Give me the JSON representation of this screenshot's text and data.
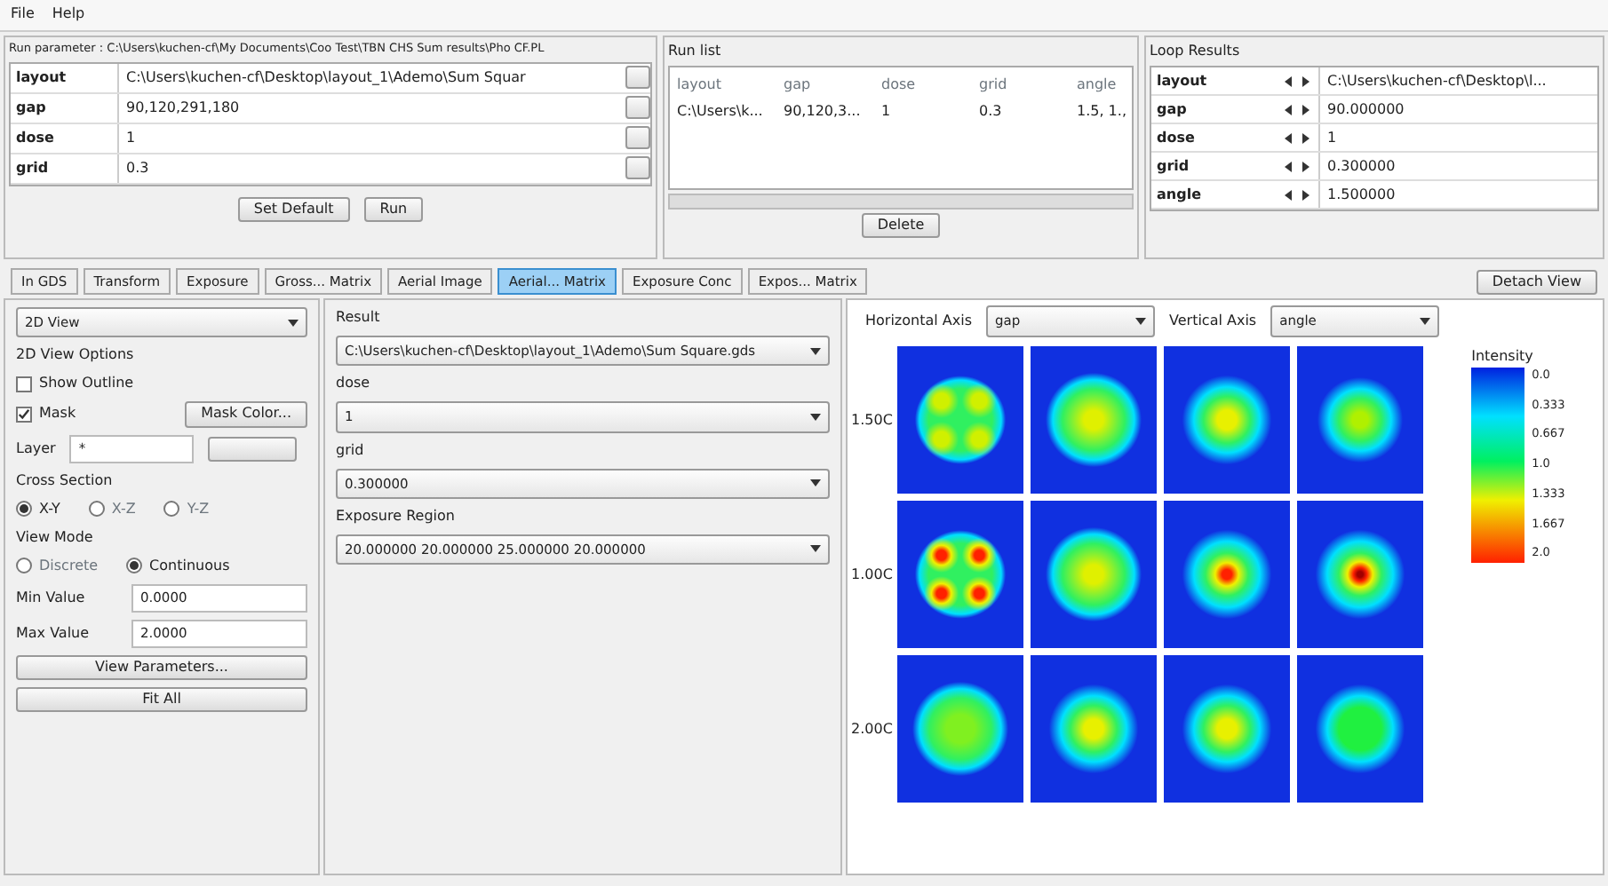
{
  "menu": [
    "File",
    "Help"
  ],
  "run_parameter": {
    "title": "Run parameter : C:\\Users\\kuchen-cf\\My Documents\\Coo Test\\TBN CHS Sum results\\Pho CF.PL",
    "rows": [
      {
        "name": "layout",
        "value": "C:\\Users\\kuchen-cf\\Desktop\\layout_1\\Ademo\\Sum Squar"
      },
      {
        "name": "gap",
        "value": "90,120,291,180"
      },
      {
        "name": "dose",
        "value": "1"
      },
      {
        "name": "grid",
        "value": "0.3"
      }
    ],
    "buttons": [
      "Set Default",
      "Run"
    ]
  },
  "run_list": {
    "title": "Run list",
    "columns": [
      "layout",
      "gap",
      "dose",
      "grid",
      "angle"
    ],
    "rows": [
      [
        "C:\\Users\\k...",
        "90,120,3...",
        "1",
        "0.3",
        "1.5, 1., "
      ]
    ],
    "button": "Delete"
  },
  "loop_results": {
    "title": "Loop Results",
    "rows": [
      {
        "name": "layout",
        "value": "C:\\Users\\kuchen-cf\\Desktop\\l..."
      },
      {
        "name": "gap",
        "value": "90.000000"
      },
      {
        "name": "dose",
        "value": "1"
      },
      {
        "name": "grid",
        "value": "0.300000"
      },
      {
        "name": "angle",
        "value": "1.500000"
      }
    ]
  },
  "tabs": [
    {
      "label": "In GDS",
      "selected": false
    },
    {
      "label": "Transform",
      "selected": false
    },
    {
      "label": "Exposure",
      "selected": false
    },
    {
      "label": "Gross... Matrix",
      "selected": false
    },
    {
      "label": "Aerial Image",
      "selected": false
    },
    {
      "label": "Aerial... Matrix",
      "selected": true
    },
    {
      "label": "Exposure Conc",
      "selected": false
    },
    {
      "label": "Expos... Matrix",
      "selected": false
    }
  ],
  "detach_button": "Detach View",
  "left_panel": {
    "view_select": "2D View",
    "options_title": "2D View Options",
    "checkboxes": [
      {
        "label": "Show Outline",
        "checked": false
      },
      {
        "label": "Mask",
        "checked": true
      }
    ],
    "mask_color_button": "Mask Color...",
    "layer_label": "Layer",
    "layer_value": "*",
    "cross_section_title": "Cross Section",
    "cross_section": [
      {
        "label": "X-Y",
        "selected": true
      },
      {
        "label": "X-Z",
        "selected": false
      },
      {
        "label": "Y-Z",
        "selected": false
      }
    ],
    "view_mode_title": "View Mode",
    "view_mode": [
      {
        "label": "Discrete",
        "selected": false
      },
      {
        "label": "Continuous",
        "selected": true
      }
    ],
    "min_label": "Min Value",
    "min_value": "0.0000",
    "max_label": "Max Value",
    "max_value": "2.0000",
    "buttons": [
      "View Parameters...",
      "Fit All"
    ]
  },
  "middle_panel": {
    "fields": [
      {
        "label": "Result",
        "value": "C:\\Users\\kuchen-cf\\Desktop\\layout_1\\Ademo\\Sum Square.gds"
      },
      {
        "label": "dose",
        "value": "1"
      },
      {
        "label": "grid",
        "value": "0.300000"
      },
      {
        "label": "Exposure Region",
        "value": "20.000000 20.000000 25.000000 20.000000"
      }
    ]
  },
  "plot": {
    "horizontal_label": "Horizontal Axis",
    "horizontal_value": "gap",
    "vertical_label": "Vertical Axis",
    "vertical_value": "angle",
    "row_labels": [
      "1.50C",
      "1.00C",
      "2.00C"
    ],
    "cells": [
      [
        {
          "kind": "four-spots"
        },
        {
          "kind": "square"
        },
        {
          "kind": "round"
        },
        {
          "kind": "round-dim"
        }
      ],
      [
        {
          "kind": "four-peaks"
        },
        {
          "kind": "square"
        },
        {
          "kind": "peak"
        },
        {
          "kind": "peak-strong"
        }
      ],
      [
        {
          "kind": "square-dim"
        },
        {
          "kind": "round"
        },
        {
          "kind": "round"
        },
        {
          "kind": "round-flat"
        }
      ]
    ],
    "legend": {
      "title": "Intensity",
      "ticks": [
        "0.0",
        "0.333",
        "0.667",
        "1.0",
        "1.333",
        "1.667",
        "2.0"
      ]
    }
  }
}
